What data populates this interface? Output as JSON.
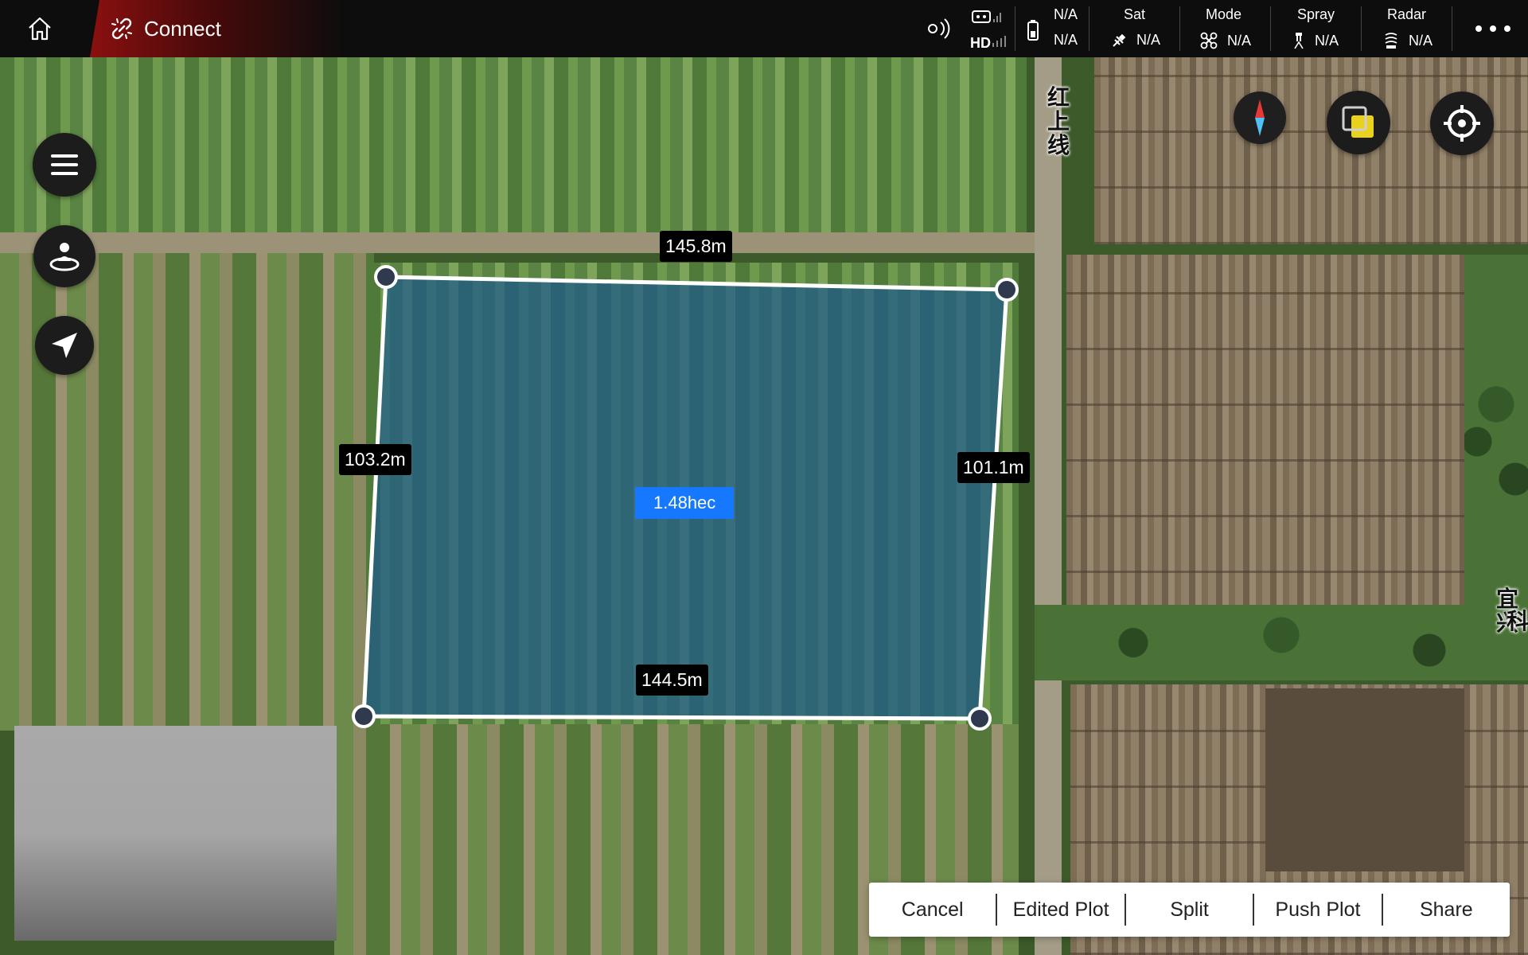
{
  "topbar": {
    "connect_label": "Connect",
    "rc_link_label": "HD",
    "battery": {
      "top": "N/A",
      "bottom": "N/A"
    },
    "groups": [
      {
        "title": "Sat",
        "value": "N/A",
        "icon": "satellite-icon"
      },
      {
        "title": "Mode",
        "value": "N/A",
        "icon": "drone-icon"
      },
      {
        "title": "Spray",
        "value": "N/A",
        "icon": "nozzle-icon"
      },
      {
        "title": "Radar",
        "value": "N/A",
        "icon": "radar-icon"
      }
    ],
    "more_icon": "more-dots-icon"
  },
  "map": {
    "labels": [
      {
        "text": "红上线"
      },
      {
        "text": "宜兴"
      },
      {
        "text": "科"
      }
    ]
  },
  "plot": {
    "area": "1.48hec",
    "edges": {
      "top": "145.8m",
      "left": "103.2m",
      "right": "101.1m",
      "bottom": "144.5m"
    },
    "colors": {
      "fill": "#1f5a8a",
      "stroke": "#ffffff",
      "vertex": "#2f3a4e",
      "area_badge": "#1677ff"
    }
  },
  "left_controls": [
    {
      "icon": "menu-icon"
    },
    {
      "icon": "takeoff-point-icon"
    },
    {
      "icon": "navigate-arrow-icon"
    }
  ],
  "right_controls": [
    {
      "icon": "compass-icon"
    },
    {
      "icon": "layers-icon",
      "accent": "#e8d21e"
    },
    {
      "icon": "locate-crosshair-icon"
    }
  ],
  "actions": {
    "cancel": "Cancel",
    "edited_plot": "Edited Plot",
    "split": "Split",
    "push_plot": "Push Plot",
    "share": "Share"
  }
}
